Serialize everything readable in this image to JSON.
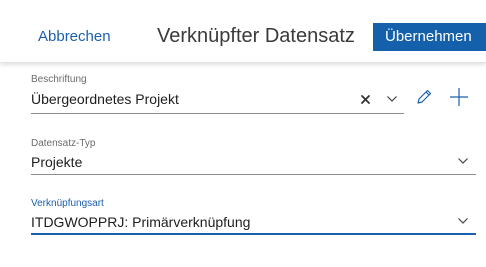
{
  "header": {
    "cancel_label": "Abbrechen",
    "title": "Verknüpfter Datensatz",
    "apply_label": "Übernehmen"
  },
  "fields": {
    "caption": {
      "label": "Beschriftung",
      "value": "Übergeordnetes Projekt"
    },
    "record_type": {
      "label": "Datensatz-Typ",
      "value": "Projekte"
    },
    "link_type": {
      "label": "Verknüpfungsart",
      "value": "ITDGWOPPRJ: Primärverknüpfung"
    }
  },
  "icons": {
    "clear": "close-icon",
    "dropdown": "chevron-down-icon",
    "edit": "pencil-icon",
    "add": "plus-icon"
  },
  "colors": {
    "accent": "#1b5fae",
    "primary_button": "#1460aa"
  }
}
